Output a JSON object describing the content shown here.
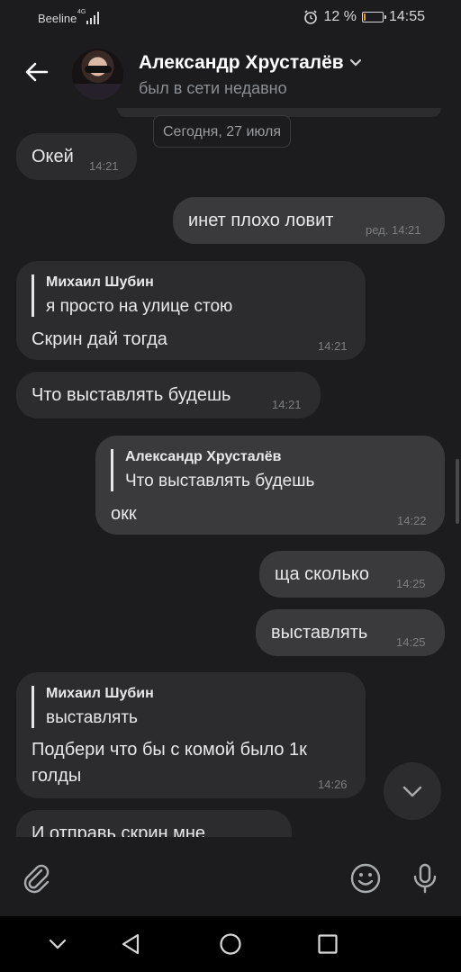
{
  "status_bar": {
    "carrier": "Beeline",
    "network": "4G",
    "battery_percent": "12 %",
    "battery_level": 0.12,
    "time": "14:55"
  },
  "header": {
    "contact_name": "Александр Хрусталёв",
    "contact_status": "был в сети недавно"
  },
  "chat": {
    "date_label": "Сегодня, 27 июля",
    "messages": [
      {
        "direction": "in",
        "text": "Окей",
        "time": "14:21"
      },
      {
        "direction": "out",
        "text": "инет плохо ловит",
        "time": "ред. 14:21"
      },
      {
        "direction": "in",
        "reply": {
          "name": "Михаил Шубин",
          "text": "я просто на улице стою"
        },
        "text": "Скрин дай тогда",
        "time": "14:21"
      },
      {
        "direction": "in",
        "text": "Что выставлять будешь",
        "time": "14:21"
      },
      {
        "direction": "out",
        "reply": {
          "name": "Александр Хрусталёв",
          "text": "Что выставлять будешь"
        },
        "text": "окк",
        "time": "14:22"
      },
      {
        "direction": "out",
        "text": "ща сколько",
        "time": "14:25"
      },
      {
        "direction": "out",
        "text": "выставлять",
        "time": "14:25"
      },
      {
        "direction": "in",
        "reply": {
          "name": "Михаил Шубин",
          "text": "выставлять"
        },
        "text_lines": [
          "Подбери что бы с комой было 1к",
          "голды"
        ],
        "time": "14:26"
      },
      {
        "direction": "in",
        "text": "И отправь скрин мне"
      }
    ]
  },
  "composer": {
    "placeholder": ""
  },
  "icons": {
    "back": "arrow-left-icon",
    "chevron": "chevron-down-icon",
    "attach": "paperclip-icon",
    "emoji": "smiley-icon",
    "mic": "microphone-icon",
    "scroll_down": "chevron-down-icon",
    "nav_hide": "chevron-down-icon",
    "nav_back": "triangle-back-icon",
    "nav_home": "circle-home-icon",
    "nav_recent": "square-recents-icon"
  },
  "colors": {
    "background": "#1c1c1e",
    "bubble_in": "#2c2c2e",
    "bubble_out": "#3a3a3c",
    "battery": "#f39c12"
  }
}
